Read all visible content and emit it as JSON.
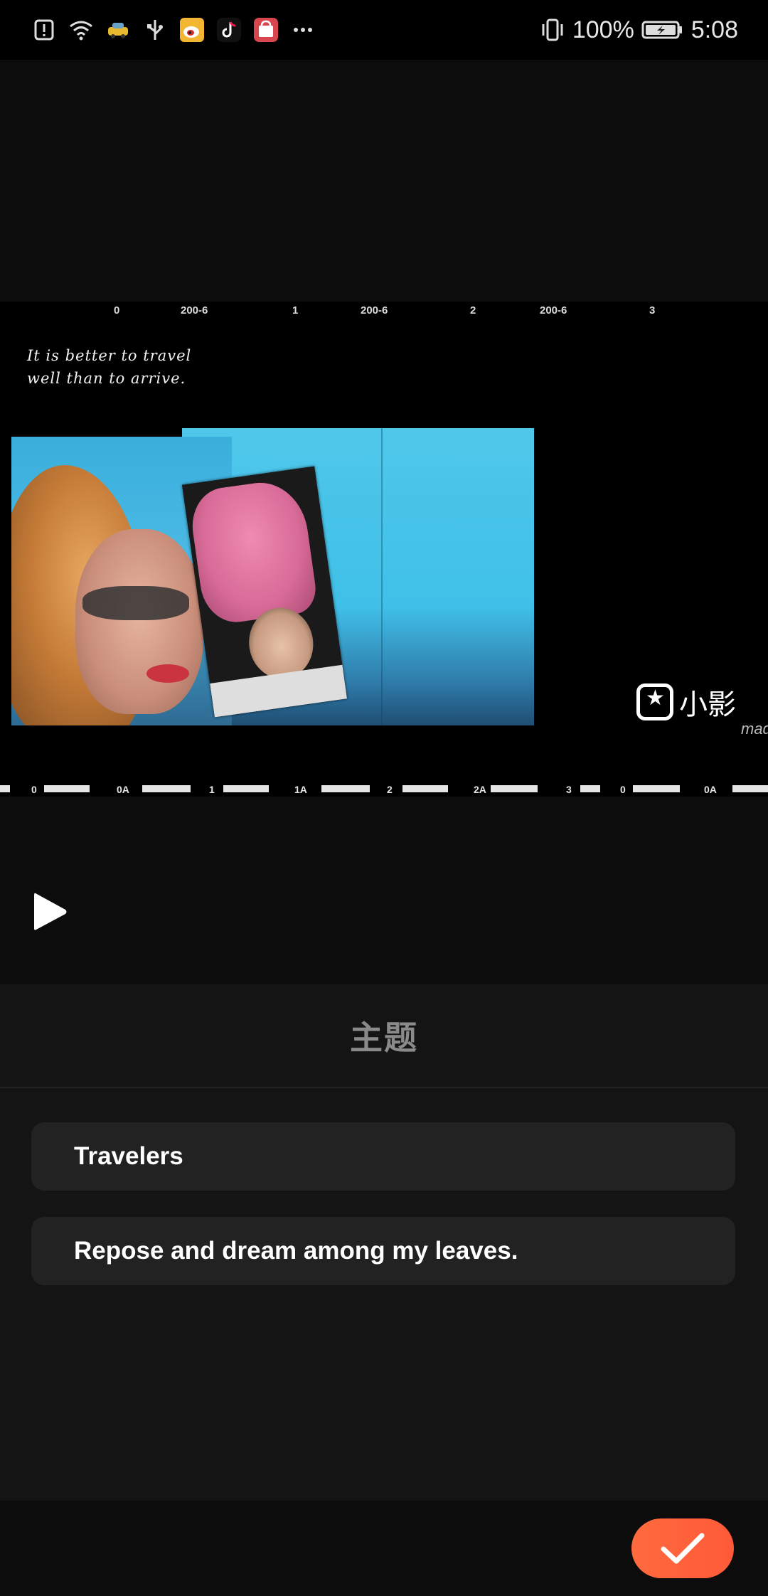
{
  "status_bar": {
    "battery_percent": "100%",
    "time": "5:08",
    "icons": [
      "alert-icon",
      "wifi-icon",
      "taxi-app-icon",
      "usb-icon",
      "weibo-icon",
      "tiktok-icon",
      "shopping-app-icon",
      "more-notifications-icon",
      "vibrate-icon",
      "battery-charging-icon"
    ]
  },
  "preview": {
    "film_top_labels": [
      "0",
      "200-6",
      "1",
      "200-6",
      "2",
      "200-6",
      "3"
    ],
    "film_bottom_labels": [
      "0",
      "0A",
      "1",
      "1A",
      "2",
      "2A",
      "3",
      "0",
      "0A"
    ],
    "quote_line1": "It is better to travel",
    "quote_line2": "well than to arrive.",
    "watermark_text": "小影",
    "watermark_sub": "made"
  },
  "theme_panel": {
    "title": "主题",
    "fields": [
      {
        "value": "Travelers"
      },
      {
        "value": "Repose and dream among my leaves."
      }
    ]
  },
  "colors": {
    "accent": "#ff603b",
    "panel_bg": "#141414",
    "field_bg": "#222222"
  }
}
